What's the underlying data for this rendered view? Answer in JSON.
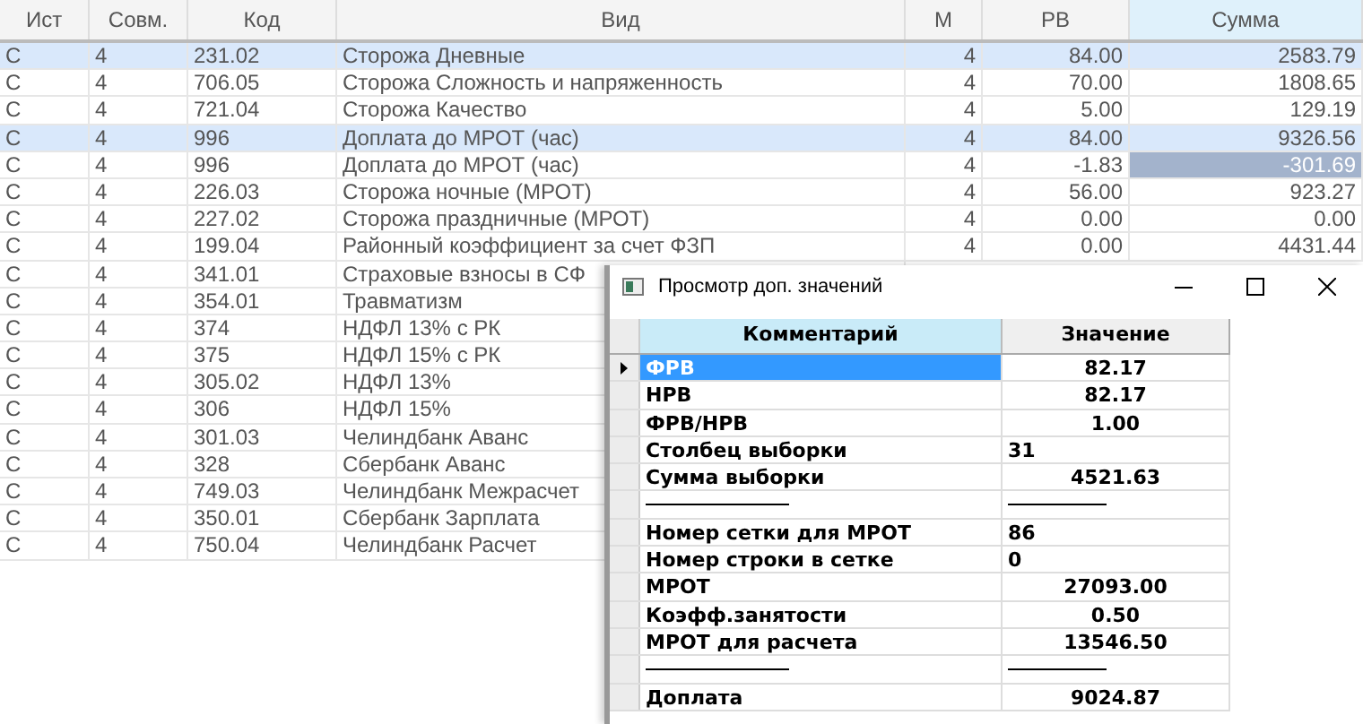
{
  "table": {
    "columns": [
      "Ист",
      "Совм.",
      "Код",
      "Вид",
      "М",
      "РВ",
      "Сумма"
    ],
    "rows": [
      {
        "cells": [
          "С",
          "4",
          "231.02",
          "Сторожа Дневные",
          "4",
          "84.00",
          "2583.79"
        ],
        "selected": true,
        "current": false
      },
      {
        "cells": [
          "С",
          "4",
          "706.05",
          "Сторожа Сложность и напряженность",
          "4",
          "70.00",
          "1808.65"
        ],
        "selected": false,
        "current": false
      },
      {
        "cells": [
          "С",
          "4",
          "721.04",
          "Сторожа Качество",
          "4",
          "5.00",
          "129.19"
        ],
        "selected": false,
        "current": false
      },
      {
        "cells": [
          "С",
          "4",
          "996",
          "Доплата до МРОТ (час)",
          "4",
          "84.00",
          "9326.56"
        ],
        "selected": true,
        "current": false
      },
      {
        "cells": [
          "С",
          "4",
          "996",
          "Доплата до МРОТ (час)",
          "4",
          "-1.83",
          "-301.69"
        ],
        "selected": false,
        "current": true
      },
      {
        "cells": [
          "С",
          "4",
          "226.03",
          "Сторожа ночные (МРОТ)",
          "4",
          "56.00",
          "923.27"
        ],
        "selected": false,
        "current": false
      },
      {
        "cells": [
          "С",
          "4",
          "227.02",
          "Сторожа праздничные (МРОТ)",
          "4",
          "0.00",
          "0.00"
        ],
        "selected": false,
        "current": false
      },
      {
        "cells": [
          "С",
          "4",
          "199.04",
          "Районный коэффициент за счет ФЗП",
          "4",
          "0.00",
          "4431.44"
        ],
        "selected": false,
        "current": false
      },
      {
        "cells": [
          "С",
          "4",
          "341.01",
          "Страховые взносы в СФ"
        ],
        "selected": false
      },
      {
        "cells": [
          "С",
          "4",
          "354.01",
          "Травматизм"
        ],
        "selected": false
      },
      {
        "cells": [
          "С",
          "4",
          "374",
          "НДФЛ 13% с РК"
        ],
        "selected": false
      },
      {
        "cells": [
          "С",
          "4",
          "375",
          "НДФЛ 15% с РК"
        ],
        "selected": false
      },
      {
        "cells": [
          "С",
          "4",
          "305.02",
          "НДФЛ 13%"
        ],
        "selected": false
      },
      {
        "cells": [
          "С",
          "4",
          "306",
          "НДФЛ 15%"
        ],
        "selected": false
      },
      {
        "cells": [
          "С",
          "4",
          "301.03",
          "Челиндбанк Аванс"
        ],
        "selected": false
      },
      {
        "cells": [
          "С",
          "4",
          "328",
          "Сбербанк Аванс"
        ],
        "selected": false
      },
      {
        "cells": [
          "С",
          "4",
          "749.03",
          "Челиндбанк Межрасчет"
        ],
        "selected": false
      },
      {
        "cells": [
          "С",
          "4",
          "350.01",
          "Сбербанк Зарплата"
        ],
        "selected": false
      },
      {
        "cells": [
          "С",
          "4",
          "750.04",
          "Челиндбанк Расчет"
        ],
        "selected": false
      }
    ]
  },
  "dialog": {
    "title": "Просмотр доп. значений",
    "columns": [
      "Комментарий",
      "Значение"
    ],
    "rows": [
      {
        "kind": "number",
        "comment": "ФРВ",
        "value": "82.17",
        "selected": true
      },
      {
        "kind": "number",
        "comment": "НРВ",
        "value": "82.17",
        "selected": false
      },
      {
        "kind": "number",
        "comment": "ФРВ/НРВ",
        "value": "1.00",
        "selected": false
      },
      {
        "kind": "text",
        "comment": "Столбец выборки",
        "value": "31",
        "selected": false
      },
      {
        "kind": "number",
        "comment": "Сумма выборки",
        "value": "4521.63",
        "selected": false
      },
      {
        "kind": "separator",
        "selected": false
      },
      {
        "kind": "text",
        "comment": "Номер сетки для МРОТ",
        "value": "86",
        "selected": false
      },
      {
        "kind": "text",
        "comment": "Номер строки в сетке",
        "value": "0",
        "selected": false
      },
      {
        "kind": "number",
        "comment": "МРОТ",
        "value": "27093.00",
        "selected": false
      },
      {
        "kind": "number",
        "comment": "Коэфф.занятости",
        "value": "0.50",
        "selected": false
      },
      {
        "kind": "number",
        "comment": "МРОТ для расчета",
        "value": "13546.50",
        "selected": false
      },
      {
        "kind": "separator",
        "selected": false
      },
      {
        "kind": "number",
        "comment": "Доплата",
        "value": "9024.87",
        "selected": false
      }
    ]
  }
}
